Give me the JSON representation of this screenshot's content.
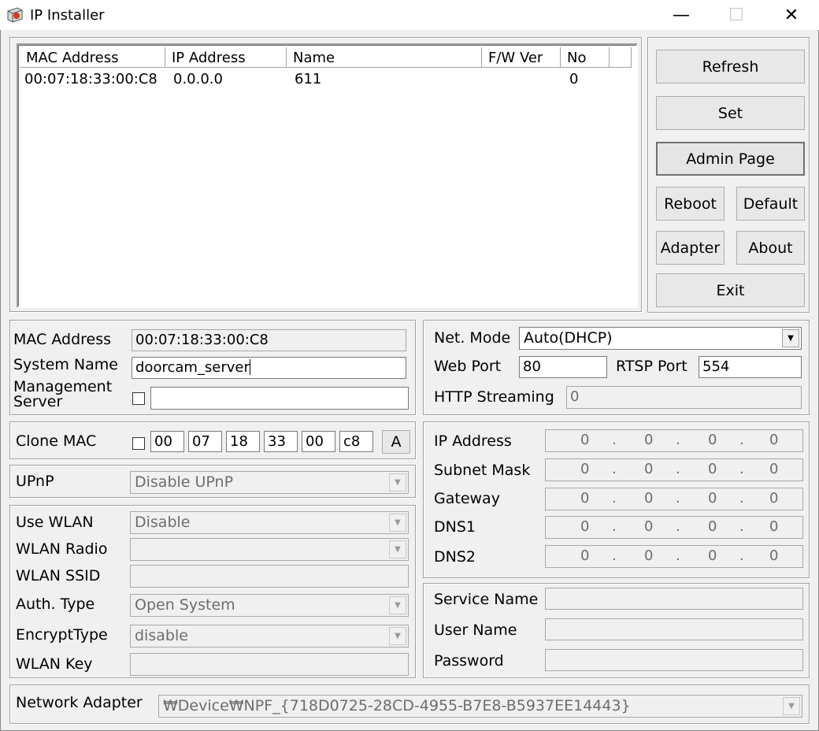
{
  "window": {
    "title": "IP Installer",
    "minimize_glyph": "—",
    "maximize_glyph": "☐",
    "close_glyph": "✕"
  },
  "device_list": {
    "columns": [
      "MAC Address",
      "IP Address",
      "Name",
      "F/W Ver",
      "No"
    ],
    "rows": [
      {
        "mac": "00:07:18:33:00:C8",
        "ip": "0.0.0.0",
        "name": "611",
        "fw": "",
        "no": "0"
      }
    ]
  },
  "side_buttons": {
    "refresh": "Refresh",
    "set": "Set",
    "admin_page": "Admin Page",
    "reboot": "Reboot",
    "default": "Default",
    "adapter": "Adapter",
    "about": "About",
    "exit": "Exit"
  },
  "device_info": {
    "mac_label": "MAC Address",
    "mac_value": "00:07:18:33:00:C8",
    "system_name_label": "System Name",
    "system_name_value": "doorcam_server",
    "mgmt_label_line1": "Management",
    "mgmt_label_line2": "Server",
    "mgmt_value": ""
  },
  "network": {
    "net_mode_label": "Net. Mode",
    "net_mode_value": "Auto(DHCP)",
    "web_port_label": "Web Port",
    "web_port_value": "80",
    "rtsp_port_label": "RTSP Port",
    "rtsp_port_value": "554",
    "http_streaming_label": "HTTP Streaming",
    "http_streaming_value": "0"
  },
  "clone_mac": {
    "label": "Clone MAC",
    "octets": [
      "00",
      "07",
      "18",
      "33",
      "00",
      "c8"
    ],
    "apply_label": "A"
  },
  "upnp": {
    "label": "UPnP",
    "value": "Disable UPnP"
  },
  "wlan": {
    "use_wlan_label": "Use WLAN",
    "use_wlan_value": "Disable",
    "radio_label": "WLAN Radio",
    "radio_value": "",
    "ssid_label": "WLAN SSID",
    "ssid_value": "",
    "auth_label": "Auth. Type",
    "auth_value": "Open System",
    "encrypt_label": "EncryptType",
    "encrypt_value": "disable",
    "key_label": "WLAN Key",
    "key_value": ""
  },
  "ip_settings": {
    "rows": [
      {
        "label": "IP Address",
        "octets": [
          "0",
          "0",
          "0",
          "0"
        ]
      },
      {
        "label": "Subnet Mask",
        "octets": [
          "0",
          "0",
          "0",
          "0"
        ]
      },
      {
        "label": "Gateway",
        "octets": [
          "0",
          "0",
          "0",
          "0"
        ]
      },
      {
        "label": "DNS1",
        "octets": [
          "0",
          "0",
          "0",
          "0"
        ]
      },
      {
        "label": "DNS2",
        "octets": [
          "0",
          "0",
          "0",
          "0"
        ]
      }
    ],
    "dot": "."
  },
  "service": {
    "service_name_label": "Service Name",
    "user_name_label": "User Name",
    "password_label": "Password"
  },
  "adapter": {
    "label": "Network Adapter",
    "value": "₩Device₩NPF_{718D0725-28CD-4955-B7E8-B5937EE14443}"
  }
}
